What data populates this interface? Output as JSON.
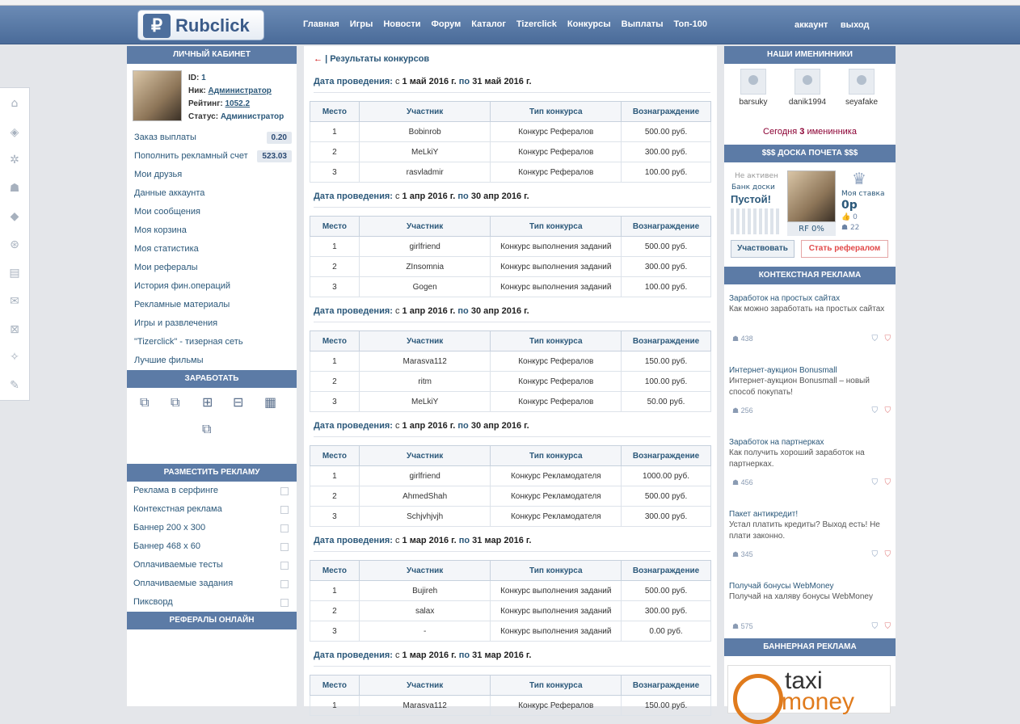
{
  "logo": {
    "mark": "₽",
    "text": "Rubclick"
  },
  "nav": [
    "Главная",
    "Игры",
    "Новости",
    "Форум",
    "Каталог",
    "Tizerclick",
    "Конкурсы",
    "Выплаты",
    "Топ-100"
  ],
  "nav_right": [
    "аккаунт",
    "выход"
  ],
  "left": {
    "header": "ЛИЧНЫЙ КАБИНЕТ",
    "profile": {
      "id_label": "ID:",
      "id": "1",
      "nick_label": "Ник:",
      "nick": "Администратор",
      "rating_label": "Рейтинг:",
      "rating": "1052.2",
      "status_label": "Статус:",
      "status": "Администратор"
    },
    "menu": [
      {
        "label": "Заказ выплаты",
        "badge": "0.20"
      },
      {
        "label": "Пополнить рекламный счет",
        "badge": "523.03"
      },
      {
        "label": "Мои друзья"
      },
      {
        "label": "Данные аккаунта"
      },
      {
        "label": "Мои сообщения"
      },
      {
        "label": "Моя корзина"
      },
      {
        "label": "Моя статистика"
      },
      {
        "label": "Мои рефералы"
      },
      {
        "label": "История фин.операций"
      },
      {
        "label": "Рекламные материалы"
      },
      {
        "label": "Игры и развлечения"
      },
      {
        "label": "\"Tizerclick\" - тизерная сеть"
      },
      {
        "label": "Лучшие фильмы"
      }
    ],
    "earn_header": "ЗАРАБОТАТЬ",
    "place_header": "РАЗМЕСТИТЬ РЕКЛАМУ",
    "place_menu": [
      "Реклама в серфинге",
      "Контекстная реклама",
      "Баннер 200 x 300",
      "Баннер 468 x 60",
      "Оплачиваемые тесты",
      "Оплачиваемые задания",
      "Пиксворд"
    ],
    "refs_header": "РЕФЕРАЛЫ ОНЛАЙН"
  },
  "main": {
    "crumb_arrow": "←",
    "crumb": "| Результаты конкурсов",
    "date_label": "Дата проведения:",
    "from": "с",
    "to": "по",
    "columns": [
      "Место",
      "Участник",
      "Тип конкурса",
      "Вознаграждение"
    ],
    "contests": [
      {
        "start": "1 май 2016 г.",
        "end": "31 май 2016 г.",
        "rows": [
          [
            "1",
            "Bobinrob",
            "Конкурс Рефералов",
            "500.00 руб."
          ],
          [
            "2",
            "MeLkiY",
            "Конкурс Рефералов",
            "300.00 руб."
          ],
          [
            "3",
            "rasvladmir",
            "Конкурс Рефералов",
            "100.00 руб."
          ]
        ]
      },
      {
        "start": "1 апр 2016 г.",
        "end": "30 апр 2016 г.",
        "rows": [
          [
            "1",
            "girlfriend",
            "Конкурс выполнения заданий",
            "500.00 руб."
          ],
          [
            "2",
            "ZInsomnia",
            "Конкурс выполнения заданий",
            "300.00 руб."
          ],
          [
            "3",
            "Gogen",
            "Конкурс выполнения заданий",
            "100.00 руб."
          ]
        ]
      },
      {
        "start": "1 апр 2016 г.",
        "end": "30 апр 2016 г.",
        "rows": [
          [
            "1",
            "Marasva112",
            "Конкурс Рефералов",
            "150.00 руб."
          ],
          [
            "2",
            "ritm",
            "Конкурс Рефералов",
            "100.00 руб."
          ],
          [
            "3",
            "MeLkiY",
            "Конкурс Рефералов",
            "50.00 руб."
          ]
        ]
      },
      {
        "start": "1 апр 2016 г.",
        "end": "30 апр 2016 г.",
        "rows": [
          [
            "1",
            "girlfriend",
            "Конкурс Рекламодателя",
            "1000.00 руб."
          ],
          [
            "2",
            "AhmedShah",
            "Конкурс Рекламодателя",
            "500.00 руб."
          ],
          [
            "3",
            "Schjvhjvjh",
            "Конкурс Рекламодателя",
            "300.00 руб."
          ]
        ]
      },
      {
        "start": "1 мар 2016 г.",
        "end": "31 мар 2016 г.",
        "rows": [
          [
            "1",
            "Bujireh",
            "Конкурс выполнения заданий",
            "500.00 руб."
          ],
          [
            "2",
            "salax",
            "Конкурс выполнения заданий",
            "300.00 руб."
          ],
          [
            "3",
            "-",
            "Конкурс выполнения заданий",
            "0.00 руб."
          ]
        ]
      },
      {
        "start": "1 мар 2016 г.",
        "end": "31 мар 2016 г.",
        "rows": [
          [
            "1",
            "Marasva112",
            "Конкурс Рефералов",
            "150.00 руб."
          ]
        ]
      }
    ]
  },
  "right": {
    "bday_header": "НАШИ ИМЕНИННИКИ",
    "bdays": [
      "barsuky",
      "danik1994",
      "seyafake"
    ],
    "bday_text_pre": "Сегодня",
    "bday_count": "3",
    "bday_text_post": "именинника",
    "board_header": "$$$ ДОСКА ПОЧЕТА $$$",
    "board": {
      "not_active": "Не активен",
      "bank": "Банк доски",
      "empty": "Пустой!",
      "rf": "RF 0%",
      "my_bet": "Моя ставка",
      "stake": "0р",
      "likes": "0",
      "users": "22",
      "btn_participate": "Участвовать",
      "btn_referral": "Стать рефералом"
    },
    "ctx_header": "КОНТЕКСТНАЯ РЕКЛАМА",
    "ads": [
      {
        "title": "Заработок на простых сайтах",
        "desc": "Как можно заработать на простых сайтах",
        "views": "438"
      },
      {
        "title": "Интернет-аукцион Bonusmall",
        "desc": "Интернет-аукцион Bonusmall – новый способ покупать!",
        "views": "256"
      },
      {
        "title": "Заработок на партнерках",
        "desc": "Как получить хороший заработок на партнерках.",
        "views": "456"
      },
      {
        "title": "Пакет антикредит!",
        "desc": "Устал платить кредиты? Выход есть! Не плати законно.",
        "views": "345"
      },
      {
        "title": "Получай бонусы WebMoney",
        "desc": "Получай на халяву бонусы WebMoney",
        "views": "575"
      }
    ],
    "banner_header": "БАННЕРНАЯ РЕКЛАМА",
    "banner": {
      "line1": "taxi",
      "line2": "money"
    }
  }
}
